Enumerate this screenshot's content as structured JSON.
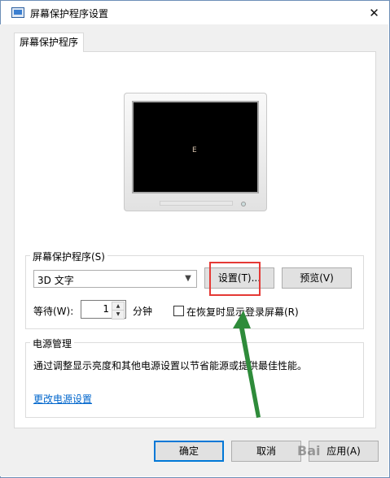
{
  "window": {
    "title": "屏幕保护程序设置",
    "close_glyph": "✕"
  },
  "tab": {
    "label": "屏幕保护程序"
  },
  "preview": {
    "screen_text": "E"
  },
  "screensaver": {
    "group_label": "屏幕保护程序(S)",
    "selected": "3D 文字",
    "settings_label": "设置(T)...",
    "preview_label": "预览(V)",
    "wait_label": "等待(W):",
    "wait_value": "1",
    "wait_unit": "分钟",
    "resume_label": "在恢复时显示登录屏幕(R)",
    "resume_checked": false
  },
  "power": {
    "group_label": "电源管理",
    "description": "通过调整显示亮度和其他电源设置以节省能源或提供最佳性能。",
    "link_label": "更改电源设置"
  },
  "footer": {
    "ok_label": "确定",
    "cancel_label": "取消",
    "apply_label": "应用(A)"
  },
  "annotation": {
    "highlight_color": "#e53935",
    "arrow_color": "#2e8b3a"
  },
  "watermark": {
    "text": "Bai"
  }
}
